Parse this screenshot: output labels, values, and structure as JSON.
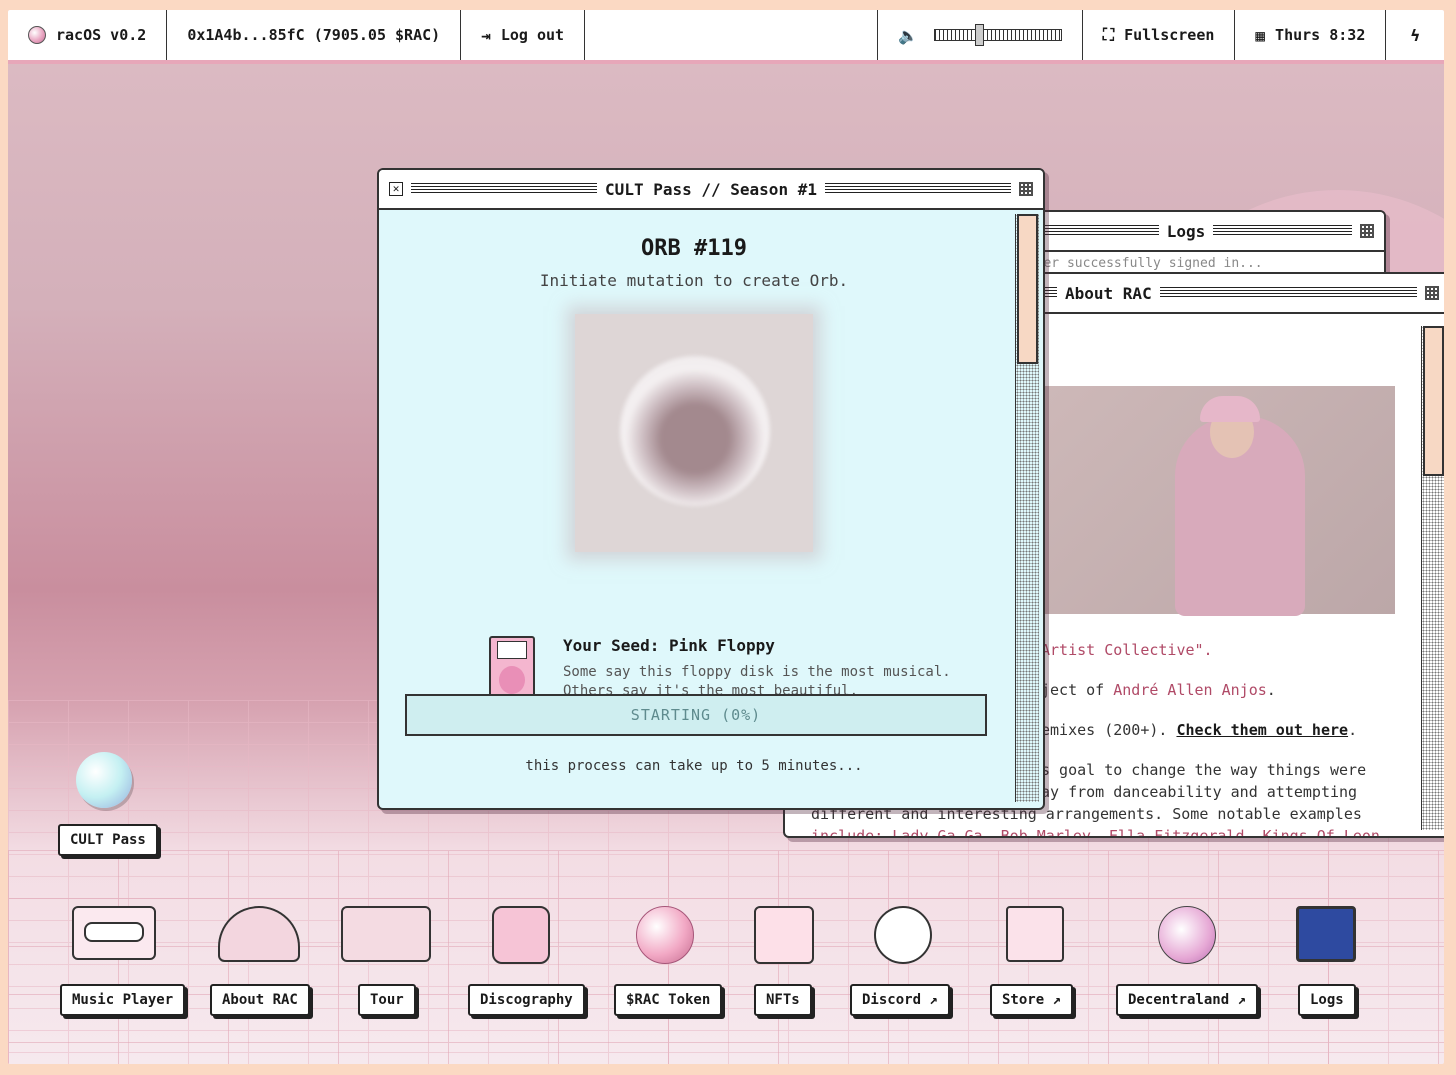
{
  "topbar": {
    "os_name": "racOS v0.2",
    "wallet": "0x1A4b...85fC (7905.05 $RAC)",
    "logout": "Log out",
    "volume_icon": "speaker-icon",
    "volume_level": 0.35,
    "fullscreen": "Fullscreen",
    "clock": "Thurs 8:32",
    "bolt_icon": "lightning-icon"
  },
  "windows": {
    "cult_pass": {
      "title": "CULT Pass // Season #1",
      "orb_title": "ORB #119",
      "subtitle": "Initiate mutation to create Orb.",
      "seed_title": "Your Seed: Pink Floppy",
      "seed_desc_1": "Some say this floppy disk is the most musical.",
      "seed_desc_2": "Others say it's the most beautiful.",
      "progress_label": "STARTING (0%)",
      "progress_value": 0,
      "note": "this process can take up to 5 minutes..."
    },
    "logs": {
      "title": "Logs",
      "snippet": "...er successfully signed in..."
    },
    "about": {
      "title": "About RAC",
      "line1": "Artist Collective\".",
      "line2a": "ject of ",
      "line2b": "André Allen Anjos",
      "line2c": ".",
      "line3a": "emixes (200+). ",
      "line3b": "Check them out here",
      "line3c": ".",
      "line4": "s goal to change the way things were",
      "line5": "ay from danceability and attempting",
      "line6": "different and interesting arrangements. Some notable examples",
      "line7": "include: Lady Ga Ga, Bob Marley, Ella Fitzgerald, Kings Of Leon"
    }
  },
  "desktop": {
    "cult_pass_label": "CULT Pass",
    "icons": [
      {
        "label": "Music Player",
        "icon": "cassette-icon"
      },
      {
        "label": "About RAC",
        "icon": "cap-icon"
      },
      {
        "label": "Tour",
        "icon": "ticket-icon"
      },
      {
        "label": "Discography",
        "icon": "music-lock-icon"
      },
      {
        "label": "$RAC Token",
        "icon": "pink-orb-icon"
      },
      {
        "label": "NFTs",
        "icon": "drawer-icon"
      },
      {
        "label": "Discord ↗",
        "icon": "discord-icon"
      },
      {
        "label": "Store ↗",
        "icon": "cart-icon"
      },
      {
        "label": "Decentraland ↗",
        "icon": "decentraland-icon"
      },
      {
        "label": "Logs",
        "icon": "monitor-icon"
      }
    ]
  }
}
